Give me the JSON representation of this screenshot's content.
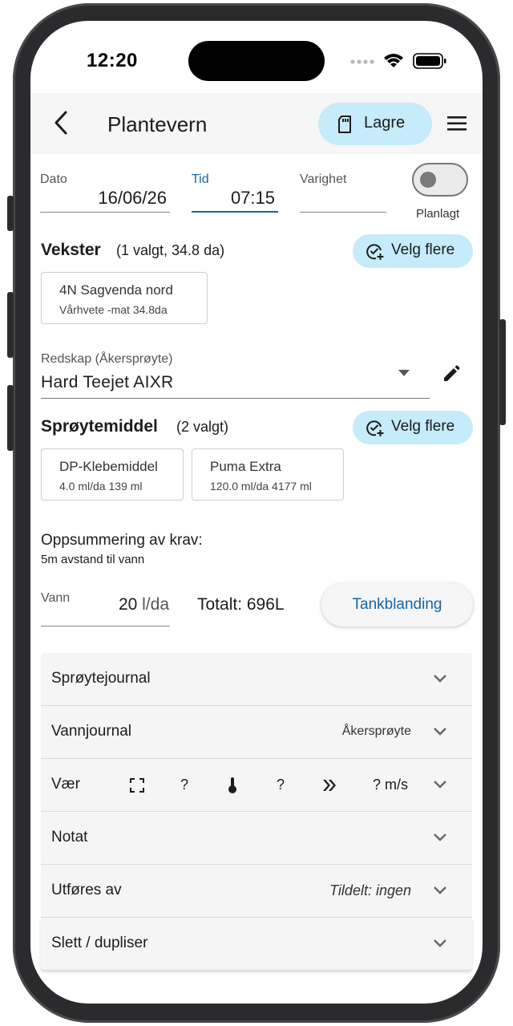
{
  "status_bar": {
    "time": "12:20"
  },
  "app_bar": {
    "title": "Plantevern",
    "save_label": "Lagre"
  },
  "form": {
    "date": {
      "label": "Dato",
      "value": "16/06/26"
    },
    "time": {
      "label": "Tid",
      "value": "07:15"
    },
    "duration": {
      "label": "Varighet",
      "value": ""
    },
    "planned": {
      "label": "Planlagt",
      "on": false
    }
  },
  "crops": {
    "title": "Vekster",
    "summary": "(1 valgt, 34.8 da)",
    "select_label": "Velg flere",
    "items": [
      {
        "name": "4N Sagvenda nord",
        "detail": "Vårhvete -mat  34.8da"
      }
    ]
  },
  "equipment": {
    "label": "Redskap (Åkersprøyte)",
    "value": "Hard Teejet AIXR"
  },
  "pesticides": {
    "title": "Sprøytemiddel",
    "summary": "(2 valgt)",
    "select_label": "Velg flere",
    "items": [
      {
        "name": "DP-Klebemiddel",
        "detail": "4.0 ml/da 139 ml"
      },
      {
        "name": "Puma Extra",
        "detail": "120.0 ml/da 4177 ml"
      }
    ]
  },
  "requirements": {
    "title": "Oppsummering av krav:",
    "text": "5m avstand til vann"
  },
  "water": {
    "label": "Vann",
    "value": "20",
    "unit": "l/da",
    "total": "Totalt: 696L",
    "tank_button": "Tankblanding"
  },
  "panels": {
    "spray_journal": {
      "title": "Sprøytejournal"
    },
    "water_journal": {
      "title": "Vannjournal",
      "right": "Åkersprøyte"
    },
    "weather": {
      "title": "Vær",
      "v1": "?",
      "v2": "?",
      "v3": "? m/s"
    },
    "note": {
      "title": "Notat"
    },
    "performed_by": {
      "title": "Utføres av",
      "right": "Tildelt: ingen"
    },
    "delete_duplicate": {
      "title": "Slett / dupliser"
    }
  },
  "colors": {
    "accent": "#1565a8",
    "pill": "#c6ebfb",
    "panel": "#f5f5f5"
  }
}
